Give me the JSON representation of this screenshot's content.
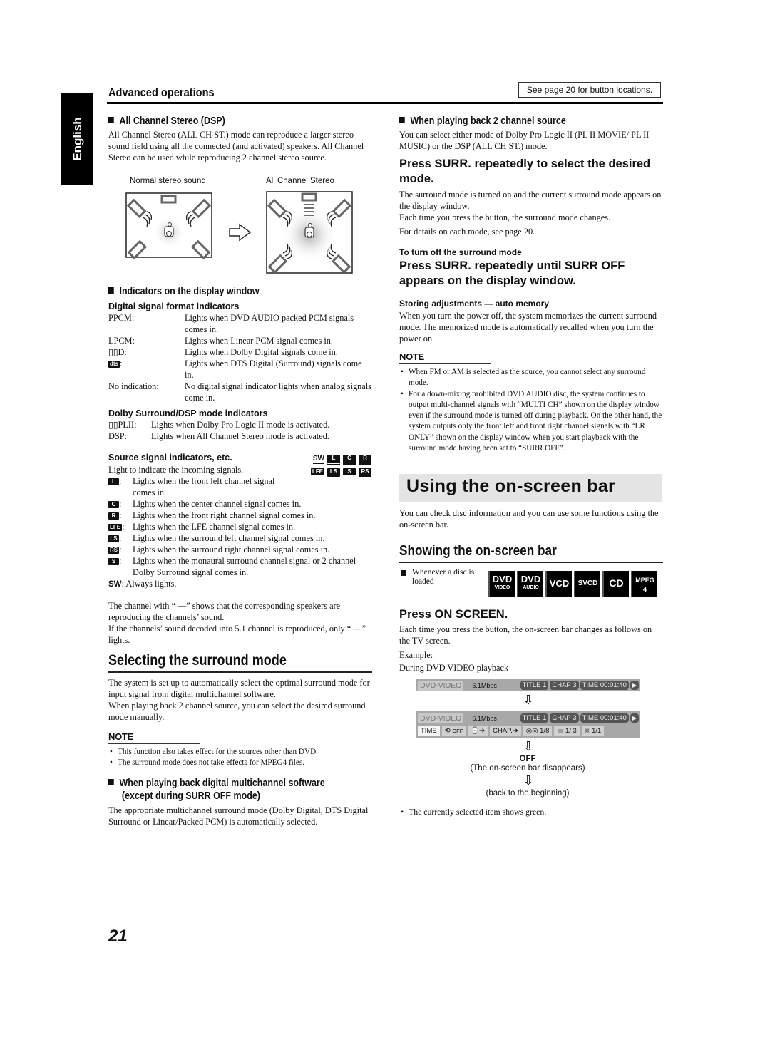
{
  "side_tab": "English",
  "header": {
    "section": "Advanced operations",
    "see_page": "See page 20 for button locations."
  },
  "left": {
    "acs": {
      "heading": "All Channel Stereo (DSP)",
      "body": "All Channel Stereo (ALL CH ST.) mode can reproduce a larger stereo sound field using all the connected (and activated) speakers. All Channel Stereo can be used while reproducing 2 channel stereo source.",
      "caption_normal": "Normal stereo sound",
      "caption_all": "All Channel Stereo"
    },
    "indicators": {
      "heading": "Indicators on the display window",
      "digital_title": "Digital signal format indicators",
      "digital": [
        {
          "key": "PPCM:",
          "desc": "Lights when DVD AUDIO packed PCM signals comes in."
        },
        {
          "key": "LPCM:",
          "desc": "Lights when Linear PCM signal comes in."
        },
        {
          "key": "▯▯D:",
          "desc": "Lights when Dolby Digital signals come in."
        },
        {
          "key": "dts:",
          "desc": "Lights when DTS Digital (Surround) signals come in."
        },
        {
          "key": "No indication:",
          "desc": "No digital signal indicator lights when analog signals come in."
        }
      ],
      "dolby_title": "Dolby Surround/DSP mode indicators",
      "dolby": [
        {
          "key": "▯▯PLII:",
          "desc": "Lights when Dolby Pro Logic II mode is activated."
        },
        {
          "key": "DSP:",
          "desc": "Lights when All Channel Stereo mode is activated."
        }
      ],
      "source_title": "Source signal indicators, etc.",
      "source_intro": "Light to indicate the incoming signals.",
      "panel": {
        "row1": [
          "SW",
          "L",
          "C",
          "R"
        ],
        "row2": [
          "LFE",
          "LS",
          "S",
          "RS"
        ]
      },
      "source": [
        {
          "key": "L",
          "desc": "Lights when the front left channel signal comes in."
        },
        {
          "key": "C",
          "desc": "Lights when the center channel signal comes in."
        },
        {
          "key": "R",
          "desc": "Lights when the front right channel signal comes in."
        },
        {
          "key": "LFE",
          "desc": "Lights when the LFE channel signal comes in."
        },
        {
          "key": "LS",
          "desc": "Lights when the surround left channel signal comes in."
        },
        {
          "key": "RS",
          "desc": "Lights when the surround right channel signal comes in."
        },
        {
          "key": "S",
          "desc": "Lights when the monaural surround channel signal or 2 channel Dolby Surround signal comes in."
        }
      ],
      "sw_key": "SW",
      "sw_desc": ": Always lights.",
      "para1": "The channel with “ —” shows that the corresponding speakers are reproducing the channels’ sound.",
      "para2": "If the channels’ sound decoded into 5.1 channel is reproduced, only “ —” lights."
    },
    "selecting": {
      "heading": "Selecting the surround mode",
      "body1": "The system is set up to automatically select the optimal surround mode for input signal from digital multichannel software.",
      "body2": "When playing back 2 channel source, you can select the desired surround mode manually.",
      "note_title": "NOTE",
      "notes": [
        "This function also takes effect for the sources other than DVD.",
        "The surround mode does not take effects for MPEG4 files."
      ],
      "multi_heading_1": "When playing back digital multichannel software",
      "multi_heading_2": "(except during SURR OFF mode)",
      "multi_body": "The appropriate multichannel surround mode (Dolby Digital, DTS Digital Surround or Linear/Packed PCM) is automatically selected."
    }
  },
  "right": {
    "two_ch": {
      "heading": "When playing back 2 channel source",
      "body": "You can select either mode of Dolby Pro Logic II (PL II MOVIE/ PL II MUSIC) or the DSP (ALL CH ST.) mode.",
      "step": "Press SURR. repeatedly to select the desired mode.",
      "step_body1": "The surround mode is turned on and the current surround mode appears on the display window.",
      "step_body2": "Each time you press the button, the surround mode changes.",
      "step_body3": "For details on each mode, see page 20.",
      "off_title": "To turn off the surround mode",
      "off_step": "Press SURR. repeatedly until SURR OFF appears on the display window.",
      "memory_title": "Storing adjustments — auto memory",
      "memory_body": "When you turn the power off, the system memorizes the current surround mode. The memorized mode is automatically recalled when you turn the power on.",
      "note_title": "NOTE",
      "notes": [
        "When FM or AM is selected as the source, you cannot select any surround mode.",
        "For a down-mixing prohibited DVD AUDIO disc, the system continues to output multi-channel signals with “MULTI CH” shown on the display window even if the surround mode is turned off during playback. On the other hand, the system outputs only the front left and front right channel signals with “LR ONLY” shown on the display window when you start playback with the surround mode having been set to “SURR OFF”."
      ]
    },
    "osb": {
      "banner": "Using the on-screen bar",
      "intro": "You can check disc information and you can use some functions using the on-screen bar.",
      "heading": "Showing the on-screen bar",
      "disc_note": "Whenever a disc is loaded",
      "discs": [
        {
          "a": "DVD",
          "b": "VIDEO"
        },
        {
          "a": "DVD",
          "b": "AUDIO"
        },
        {
          "a": "VCD",
          "b": ""
        },
        {
          "a": "SVCD",
          "b": ""
        },
        {
          "a": "CD",
          "b": ""
        },
        {
          "a": "MPEG",
          "b": "4"
        }
      ],
      "step": "Press ON SCREEN.",
      "step_body": "Each time you press the button, the on-screen bar changes as follows on the TV screen.",
      "example": "Example:",
      "example_ctx": "During DVD VIDEO playback",
      "bar": {
        "disc": "DVD-VIDEO",
        "rate": "6.1Mbps",
        "title": "TITLE  1",
        "chap": "CHAP  3",
        "time": "TIME 00:01:40",
        "play": "▶",
        "row2": [
          {
            "icon": "",
            "label": "TIME"
          },
          {
            "icon": "⟲",
            "label": "OFF"
          },
          {
            "icon": "⌚",
            "label": "➔"
          },
          {
            "icon": "",
            "label": "CHAP.➔"
          },
          {
            "icon": "◎◎",
            "label": "1/8"
          },
          {
            "icon": "▭",
            "label": "1/ 3"
          },
          {
            "icon": "⎈",
            "label": "1/1"
          }
        ]
      },
      "off_label": "OFF",
      "off_desc": "(The on-screen bar disappears)",
      "back": "(back to the beginning)",
      "final_note": "The currently selected item shows green.",
      "arrow": "⇩"
    }
  },
  "page_number": "21"
}
